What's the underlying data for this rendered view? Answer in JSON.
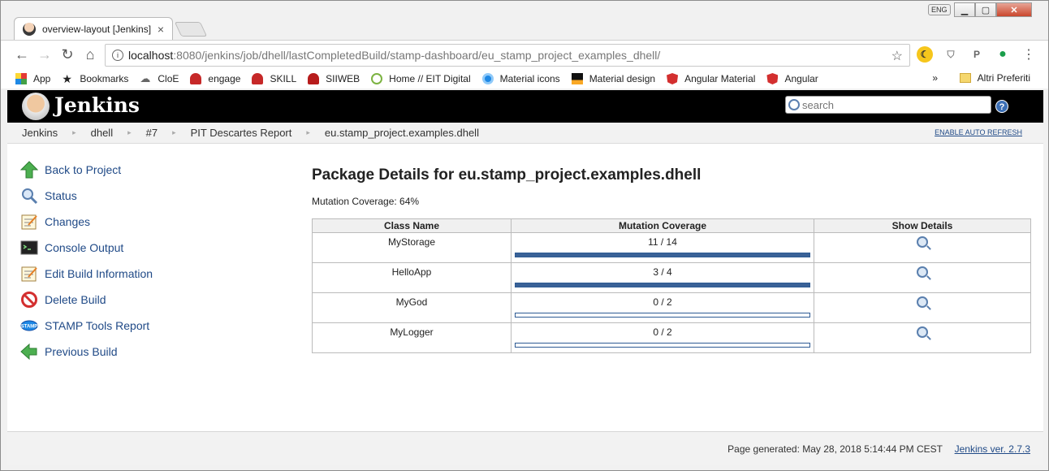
{
  "browser": {
    "tab_title": "overview-layout [Jenkins]",
    "tab_close": "×",
    "language_indicator": "ENG",
    "url_host": "localhost",
    "url_path": ":8080/jenkins/job/dhell/lastCompletedBuild/stamp-dashboard/eu_stamp_project_examples_dhell/",
    "bookmarks": [
      {
        "label": "App",
        "icon": "apps-grid-icon"
      },
      {
        "label": "Bookmarks",
        "icon": "star-icon"
      },
      {
        "label": "CloE",
        "icon": "cloud-icon"
      },
      {
        "label": "engage",
        "icon": "engage-icon"
      },
      {
        "label": "SKILL",
        "icon": "skill-icon"
      },
      {
        "label": "SIIWEB",
        "icon": "siiweb-icon"
      },
      {
        "label": "Home // EIT Digital",
        "icon": "eit-icon"
      },
      {
        "label": "Material icons",
        "icon": "material-icons-icon"
      },
      {
        "label": "Material design",
        "icon": "material-design-icon"
      },
      {
        "label": "Angular Material",
        "icon": "angular-icon"
      },
      {
        "label": "Angular",
        "icon": "angular-icon"
      }
    ],
    "bookmarks_more": "»",
    "other_bookmarks": "Altri Preferiti"
  },
  "jenkins": {
    "title": "Jenkins",
    "search_placeholder": "search",
    "help": "?"
  },
  "breadcrumb": {
    "items": [
      "Jenkins",
      "dhell",
      "#7",
      "PIT Descartes Report",
      "eu.stamp_project.examples.dhell"
    ],
    "separator": "▸",
    "auto_refresh": "ENABLE AUTO REFRESH"
  },
  "sidepanel": {
    "tasks": [
      {
        "label": "Back to Project",
        "icon": "up-arrow-icon"
      },
      {
        "label": "Status",
        "icon": "search-icon"
      },
      {
        "label": "Changes",
        "icon": "notepad-icon"
      },
      {
        "label": "Console Output",
        "icon": "terminal-icon"
      },
      {
        "label": "Edit Build Information",
        "icon": "notepad-icon"
      },
      {
        "label": "Delete Build",
        "icon": "no-entry-icon"
      },
      {
        "label": "STAMP Tools Report",
        "icon": "stamp-icon"
      },
      {
        "label": "Previous Build",
        "icon": "left-arrow-icon"
      }
    ]
  },
  "main": {
    "heading": "Package Details for eu.stamp_project.examples.dhell",
    "coverage_text": "Mutation Coverage: 64%",
    "columns": [
      "Class Name",
      "Mutation Coverage",
      "Show Details"
    ],
    "rows": [
      {
        "name": "MyStorage",
        "coverage": "11 / 14",
        "fraction": 1.0
      },
      {
        "name": "HelloApp",
        "coverage": "3 / 4",
        "fraction": 1.0
      },
      {
        "name": "MyGod",
        "coverage": "0 / 2",
        "fraction": 0.0
      },
      {
        "name": "MyLogger",
        "coverage": "0 / 2",
        "fraction": 0.0
      }
    ]
  },
  "footer": {
    "generated": "Page generated: May 28, 2018 5:14:44 PM CEST",
    "version": "Jenkins ver. 2.7.3"
  },
  "colors": {
    "header_bg": "#000000",
    "link": "#204a87",
    "bar_fill": "#3a6297"
  }
}
